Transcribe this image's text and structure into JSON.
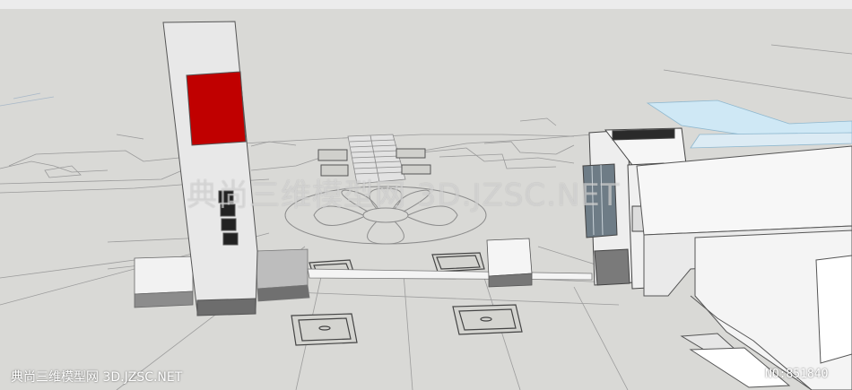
{
  "watermark": {
    "center_text": "典尚三维模型网 3D.JZSC.NET",
    "bottom_left_text": "典尚三维模型网 3D.JZSC.NET",
    "bottom_right_text": "NO:851840"
  },
  "colors": {
    "ground": "#d9d9d6",
    "sky_band": "#eeeeee",
    "pylon_face": "#e6e6e6",
    "pylon_side": "#c4c4c4",
    "red_panel": "#c00000",
    "glass": "#6e7c86",
    "water": "#cfe8f5"
  }
}
